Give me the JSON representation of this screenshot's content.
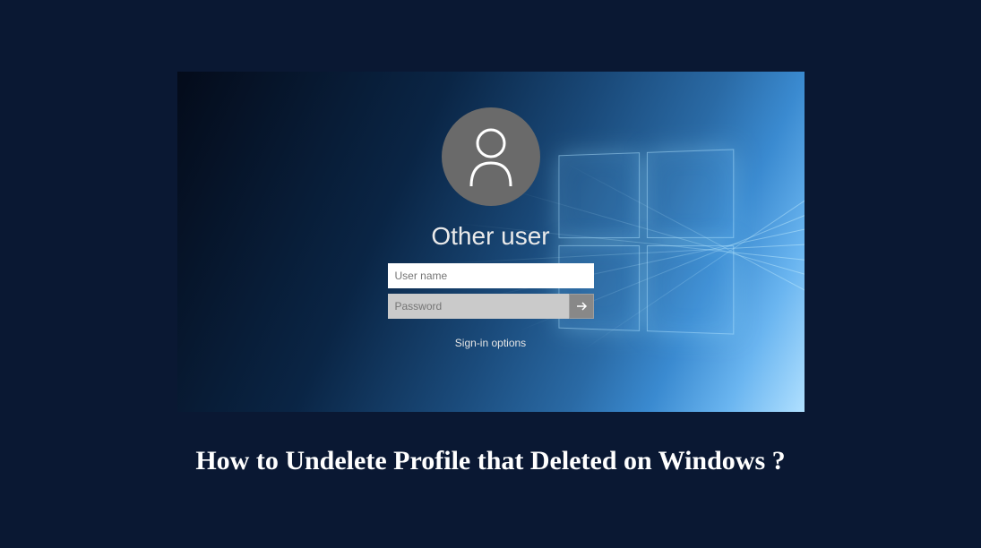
{
  "login": {
    "user_label": "Other user",
    "username_placeholder": "User name",
    "password_placeholder": "Password",
    "signin_options_label": "Sign-in options"
  },
  "caption": "How to Undelete Profile that Deleted on Windows ?",
  "colors": {
    "page_bg": "#0a1833",
    "avatar_bg": "#6a6a6a"
  }
}
